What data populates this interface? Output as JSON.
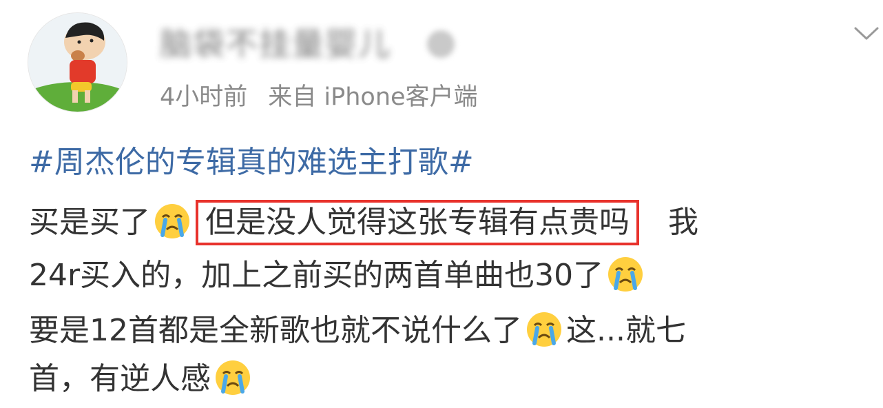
{
  "post": {
    "username": "脑袋不挂量婴儿",
    "time": "4小时前",
    "source": "来自 iPhone客户端",
    "topic": "#周杰伦的专辑真的难选主打歌#",
    "line1_start": "买是买了",
    "line1_highlight": "但是没人觉得这张专辑有点贵吗",
    "line1_end": "我",
    "line2": "24r买入的，加上之前买的两首单曲也30了",
    "line3_start": "要是12首都是全新歌也就不说什么了",
    "line3_end": "这...就七",
    "line4": "首，有逆人感"
  },
  "icons": {
    "menu": "chevron-down-icon",
    "emoji": "crying-face-emoji-icon",
    "avatar": "cartoon-boy-avatar"
  },
  "colors": {
    "topic": "#3d6aa5",
    "highlight_border": "#e8322c",
    "meta": "#8a8a8a"
  }
}
